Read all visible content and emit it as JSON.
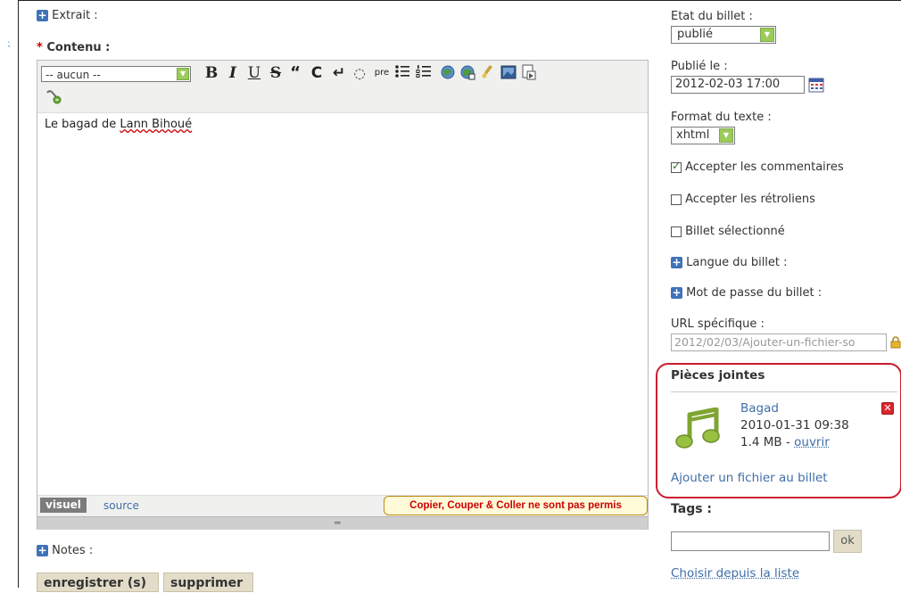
{
  "sections": {
    "extrait": "Extrait :",
    "contenu": "Contenu :",
    "notes": "Notes :"
  },
  "editor": {
    "format_select": "-- aucun --",
    "toolbar_buttons": {
      "bold": "B",
      "italic": "I",
      "underline": "U",
      "strike": "S",
      "quote": "“",
      "code": "C",
      "linebreak": "↵",
      "blockquote": "◌",
      "pre": "pre"
    },
    "content_prefix": "Le bagad de ",
    "content_misspelled": "Lann Bihoué",
    "tab_visual": "visuel",
    "tab_source": "source",
    "warning": "Copier, Couper & Coller ne sont pas permis"
  },
  "actions": {
    "save": "enregistrer (s)",
    "delete": "supprimer"
  },
  "sidebar": {
    "status_label": "Etat du billet :",
    "status_value": "publié",
    "published_label": "Publié le :",
    "published_value": "2012-02-03 17:00",
    "format_label": "Format du texte :",
    "format_value": "xhtml",
    "accept_comments": "Accepter les commentaires",
    "accept_comments_checked": true,
    "accept_trackbacks": "Accepter les rétroliens",
    "accept_trackbacks_checked": false,
    "selected": "Billet sélectionné",
    "selected_checked": false,
    "language_label": "Langue du billet :",
    "password_label": "Mot de passe du billet :",
    "url_label": "URL spécifique :",
    "url_value": "2012/02/03/Ajouter-un-fichier-so",
    "attachments_title": "Pièces jointes",
    "attachment": {
      "name": "Bagad",
      "date": "2010-01-31 09:38",
      "size": "1.4 MB - ",
      "open": "ouvrir"
    },
    "add_file": "Ajouter un fichier au billet",
    "tags_label": "Tags :",
    "tags_value": "",
    "tags_button": "ok",
    "choose_list": "Choisir depuis la liste"
  },
  "colors": {
    "accent_blue": "#3f72b8",
    "link": "#3f6ea8",
    "highlight_border": "#cc1e2e",
    "warning_text": "#cc0000"
  }
}
